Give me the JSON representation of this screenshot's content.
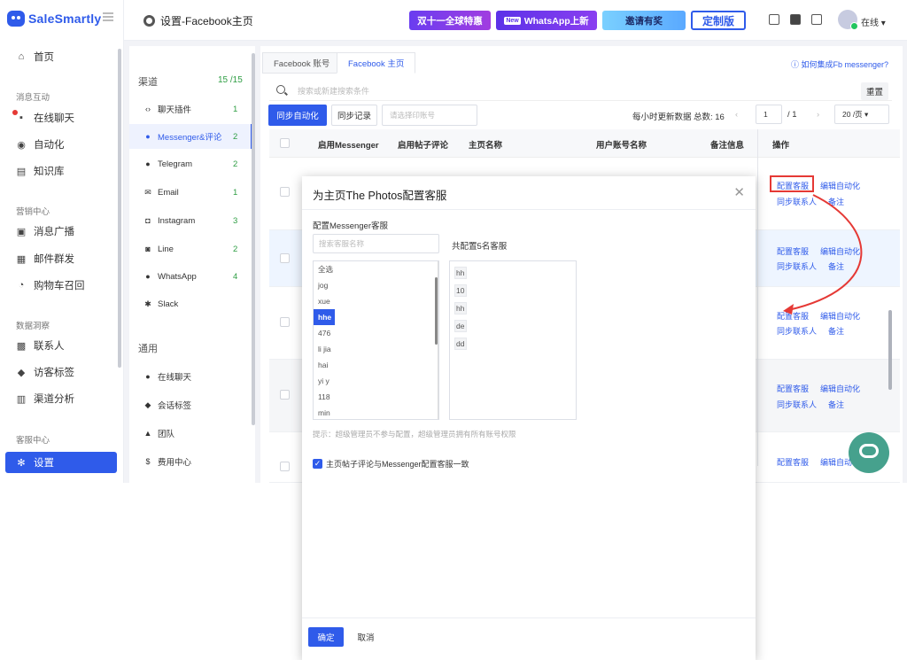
{
  "brand": {
    "name": "SaleSmartly"
  },
  "leftnav": {
    "home": "首页",
    "sec_msg": "消息互动",
    "live_chat": "在线聊天",
    "automation": "自动化",
    "kb": "知识库",
    "sec_marketing": "营销中心",
    "broadcast": "消息广播",
    "email_mass": "邮件群发",
    "cart": "购物车召回",
    "sec_data": "数据洞察",
    "contacts": "联系人",
    "visitor_tags": "访客标签",
    "channel_analysis": "渠道分析",
    "sec_service": "客服中心",
    "settings": "设置"
  },
  "topbar": {
    "title": "设置-Facebook主页",
    "promo1": "双十一全球特惠",
    "promo2_new": "New",
    "promo2": "WhatsApp上新",
    "promo3": "邀请有奖",
    "promo4": "定制版",
    "status": "在线"
  },
  "subside": {
    "sec_channels": "渠道",
    "count": "15 /15",
    "items": [
      {
        "label": "聊天插件",
        "n": "1"
      },
      {
        "label": "Messenger&评论",
        "n": "2"
      },
      {
        "label": "Telegram",
        "n": "2"
      },
      {
        "label": "Email",
        "n": "1"
      },
      {
        "label": "Instagram",
        "n": "3"
      },
      {
        "label": "Line",
        "n": "2"
      },
      {
        "label": "WhatsApp",
        "n": "4"
      },
      {
        "label": "Slack",
        "n": ""
      }
    ],
    "sec_general": "通用",
    "general": [
      "在线聊天",
      "会话标签",
      "团队",
      "费用中心"
    ]
  },
  "main": {
    "tab1": "Facebook 账号",
    "tab2": "Facebook 主页",
    "help": "如何集成Fb messenger?",
    "search_ph": "搜索或新建搜索条件",
    "reset": "重置",
    "sync_auto": "同步自动化",
    "sync_log": "同步记录",
    "select_ph": "请选择印账号",
    "hourly": "每小时更新数据",
    "total": "总数: 16",
    "page": "1",
    "page_total": "/ 1",
    "per_page": "20 /页",
    "cols": [
      "启用Messenger",
      "启用帖子评论",
      "主页名称",
      "用户账号名称",
      "备注信息",
      "操作"
    ],
    "op_config": "配置客服",
    "op_edit_auto": "编辑自动化",
    "op_sync": "同步联系人",
    "op_note": "备注"
  },
  "modal": {
    "title": "为主页The Photos配置客服",
    "label_left": "配置Messenger客服",
    "search_ph": "搜索客服名称",
    "label_right": "共配置5名客服",
    "list": [
      "全选",
      "jog",
      "xue",
      "hhe",
      "476",
      "li jia",
      "hai",
      "yi y",
      "118",
      "min"
    ],
    "selected_index": 3,
    "assigned": [
      "hh",
      "10",
      "hh",
      "de",
      "dd"
    ],
    "hint": "提示：超级管理员不参与配置，超级管理员拥有所有账号权限",
    "checkbox": "主页帖子评论与Messenger配置客服一致",
    "ok": "确定",
    "cancel": "取消"
  },
  "colors": {
    "primary": "#2f5bea",
    "annotation": "#e53935",
    "chat_bubble": "#46a18d"
  }
}
